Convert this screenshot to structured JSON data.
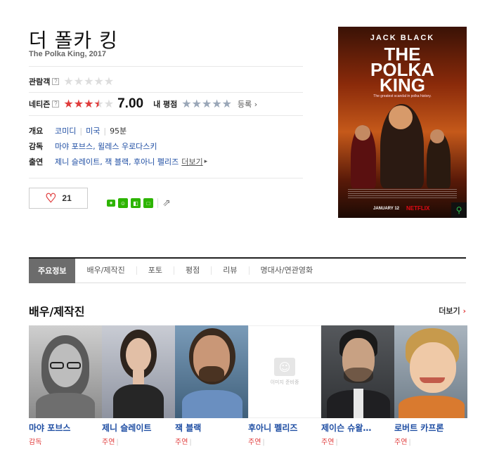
{
  "movie": {
    "title": "더 폴카 킹",
    "subtitle": "The Polka King, 2017"
  },
  "ratings": {
    "audience_label": "관람객",
    "audience_stars": 0,
    "netizen_label": "네티즌",
    "netizen_score": "7.00",
    "netizen_stars": 3.5,
    "my_rating_label": "내 평점",
    "register_label": "등록",
    "help_glyph": "?"
  },
  "info": {
    "overview_label": "개요",
    "genre": "코미디",
    "country": "미국",
    "runtime": "95분",
    "director_label": "감독",
    "directors": "마야 포브스, 윌레스 우로다스키",
    "cast_label": "출연",
    "cast": "제니 슬레이트, 잭 블랙, 후아니 펠리즈",
    "more_label": "더보기"
  },
  "actions": {
    "like_count": "21"
  },
  "poster": {
    "actor": "JACK BLACK",
    "title_line1": "THE",
    "title_line2": "POLKA",
    "title_line3": "KING",
    "tagline": "The greatest scandal in polka history.",
    "date": "JANUARY 12",
    "brand": "NETFLIX"
  },
  "tabs": [
    "주요정보",
    "배우/제작진",
    "포토",
    "평점",
    "리뷰",
    "명대사/연관영화"
  ],
  "cast_section": {
    "title": "배우/제작진",
    "more_label": "더보기",
    "no_image_text": "이미지 준비중",
    "people": [
      {
        "name": "마야 포브스",
        "role": "감독"
      },
      {
        "name": "제니 슬레이트",
        "role": "주연"
      },
      {
        "name": "잭 블랙",
        "role": "주연"
      },
      {
        "name": "후아니 펠리즈",
        "role": "주연"
      },
      {
        "name": "제이슨 슈왈…",
        "role": "주연"
      },
      {
        "name": "로버트 카프론",
        "role": "주연"
      }
    ]
  },
  "colors": {
    "accent_red": "#e03b3b",
    "link_blue": "#1f4ea3",
    "netflix_red": "#e50914"
  }
}
